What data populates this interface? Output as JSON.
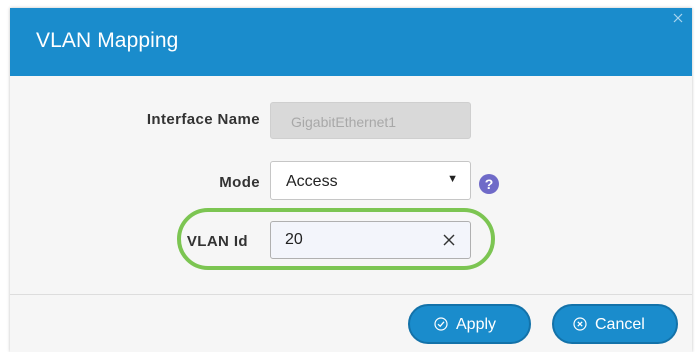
{
  "dialog": {
    "title": "VLAN Mapping",
    "close_icon": "close-icon"
  },
  "form": {
    "interface_name_label": "Interface Name",
    "interface_name_value": "GigabitEthernet1",
    "mode_label": "Mode",
    "mode_value": "Access",
    "mode_caret_icon": "caret-down-icon",
    "help_icon": "help-icon",
    "help_glyph": "?",
    "vlan_id_label": "VLAN Id",
    "vlan_id_value": "20",
    "clear_icon": "clear-icon"
  },
  "footer": {
    "apply_label": "Apply",
    "apply_icon": "check-circle-icon",
    "cancel_label": "Cancel",
    "cancel_icon": "x-circle-icon"
  },
  "colors": {
    "header_bg": "#1a8ccc",
    "button_bg": "#1a8ccc",
    "highlight_ring": "#7cc552",
    "help_icon_bg": "#6f6ac8"
  }
}
